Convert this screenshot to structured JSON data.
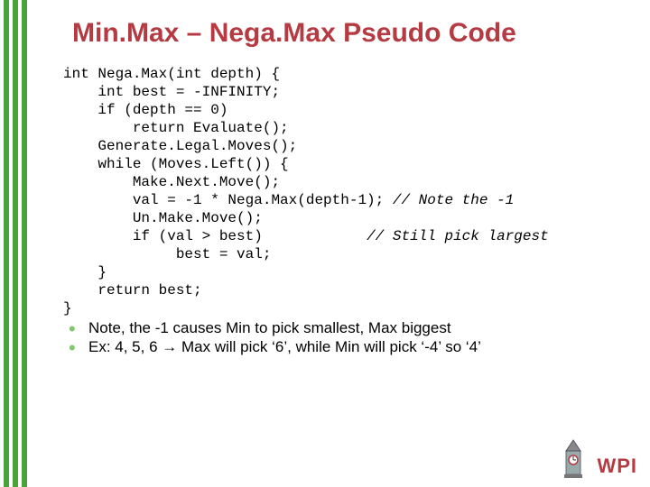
{
  "title": "Min.Max – Nega.Max Pseudo Code",
  "code": {
    "l1": "int Nega.Max(int depth) {",
    "l2": "    int best = -INFINITY;",
    "l3": "    if (depth == 0)",
    "l4": "        return Evaluate();",
    "l5": "    Generate.Legal.Moves();",
    "l6": "    while (Moves.Left()) {",
    "l7": "        Make.Next.Move();",
    "l8a": "        val = -1 * Nega.Max(depth-1); ",
    "l8b": "// Note the -1",
    "l9": "        Un.Make.Move();",
    "l10a": "        if (val > best)            ",
    "l10b": "// Still pick largest",
    "l11": "             best = val;",
    "l12": "    }",
    "l13": "    return best;",
    "l14": "}"
  },
  "bullets": {
    "b1": "Note, the -1 causes Min to pick smallest, Max biggest",
    "b2_pre": "Ex: 4, 5, 6 ",
    "b2_arrow": "→",
    "b2_post": " Max will pick ‘6’, while Min will pick ‘-4’ so ‘4’"
  },
  "logo_text": "WPI"
}
